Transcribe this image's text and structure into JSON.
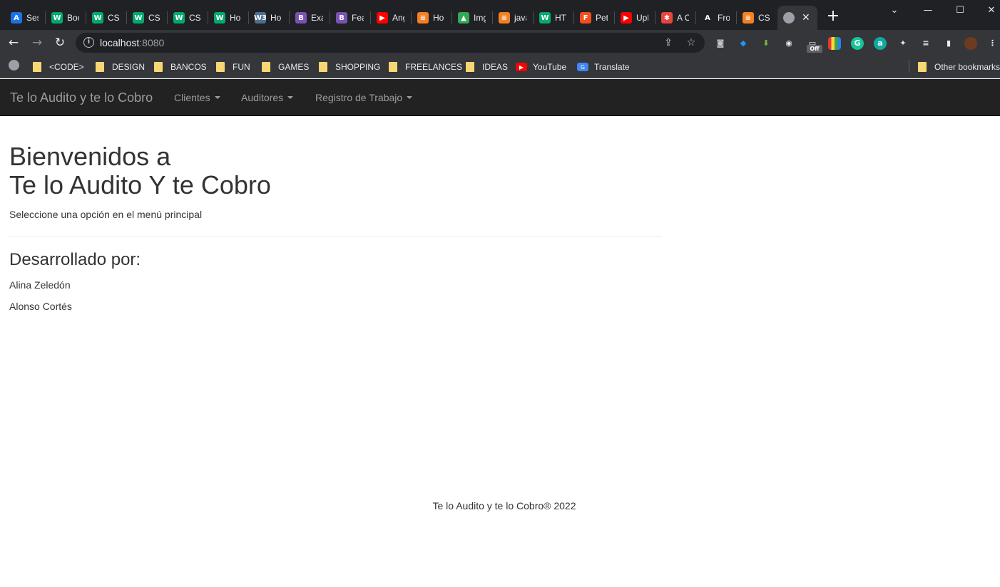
{
  "browser": {
    "tabs": [
      {
        "title": "Ses",
        "icon": "azure-icon",
        "color": "#1a73e8",
        "glyph": "A"
      },
      {
        "title": "Boo",
        "icon": "w3schools-icon",
        "color": "#04aa6d",
        "glyph": "W"
      },
      {
        "title": "CSS",
        "icon": "w3schools-icon",
        "color": "#04aa6d",
        "glyph": "W"
      },
      {
        "title": "CSS",
        "icon": "w3schools-icon",
        "color": "#04aa6d",
        "glyph": "W"
      },
      {
        "title": "CSS",
        "icon": "w3schools-icon",
        "color": "#04aa6d",
        "glyph": "W"
      },
      {
        "title": "Ho",
        "icon": "w3schools-icon",
        "color": "#04aa6d",
        "glyph": "W"
      },
      {
        "title": "Ho",
        "icon": "w3-icon",
        "color": "#4f6f8f",
        "glyph": "W3"
      },
      {
        "title": "Exa",
        "icon": "bootstrap-icon",
        "color": "#7952b3",
        "glyph": "B"
      },
      {
        "title": "Fea",
        "icon": "bootstrap-icon",
        "color": "#7952b3",
        "glyph": "B"
      },
      {
        "title": "Ang",
        "icon": "youtube-icon",
        "color": "#ff0000",
        "glyph": "▶"
      },
      {
        "title": "Ho",
        "icon": "stackoverflow-icon",
        "color": "#f48024",
        "glyph": "≡"
      },
      {
        "title": "Img",
        "icon": "google-drive-icon",
        "color": "#34a853",
        "glyph": "▲"
      },
      {
        "title": "java",
        "icon": "stackoverflow-icon",
        "color": "#f48024",
        "glyph": "≡"
      },
      {
        "title": "HTI",
        "icon": "w3schools-icon",
        "color": "#04aa6d",
        "glyph": "W"
      },
      {
        "title": "Pet",
        "icon": "figma-icon",
        "color": "#f24e1e",
        "glyph": "F"
      },
      {
        "title": "Upl",
        "icon": "youtube-icon",
        "color": "#ff0000",
        "glyph": "▶"
      },
      {
        "title": "A C",
        "icon": "asterisk-icon",
        "color": "#e8453c",
        "glyph": "✱"
      },
      {
        "title": "Fro",
        "icon": "a-logo-icon",
        "color": "#202124",
        "glyph": "A"
      },
      {
        "title": "CSS",
        "icon": "stackoverflow-icon",
        "color": "#f48024",
        "glyph": "≡"
      }
    ],
    "active_tab_close": "✕",
    "new_tab": "+",
    "url_host": "localhost",
    "url_port": ":8080",
    "bookmarks": [
      {
        "label": "<CODE>",
        "type": "folder"
      },
      {
        "label": "DESIGN",
        "type": "folder"
      },
      {
        "label": "BANCOS",
        "type": "folder"
      },
      {
        "label": "FUN",
        "type": "folder"
      },
      {
        "label": "GAMES",
        "type": "folder"
      },
      {
        "label": "SHOPPING",
        "type": "folder"
      },
      {
        "label": "FREELANCES",
        "type": "folder"
      },
      {
        "label": "IDEAS",
        "type": "folder"
      },
      {
        "label": "YouTube",
        "type": "youtube"
      },
      {
        "label": "Translate",
        "type": "translate"
      }
    ],
    "other_bookmarks": "Other bookmarks",
    "extension_badge": "Off"
  },
  "navbar": {
    "brand": "Te lo Audito y te lo Cobro",
    "menus": [
      "Clientes",
      "Auditores",
      "Registro de Trabajo"
    ]
  },
  "main": {
    "welcome_line1": "Bienvenidos a",
    "welcome_line2": "Te lo Audito Y te Cobro",
    "subtitle": "Seleccione una opción en el menú principal",
    "developed_by": "Desarrollado por:",
    "developers": [
      "Alina Zeledón",
      "Alonso Cortés"
    ]
  },
  "footer": {
    "text": "Te lo Audito y te lo Cobro® 2022"
  }
}
